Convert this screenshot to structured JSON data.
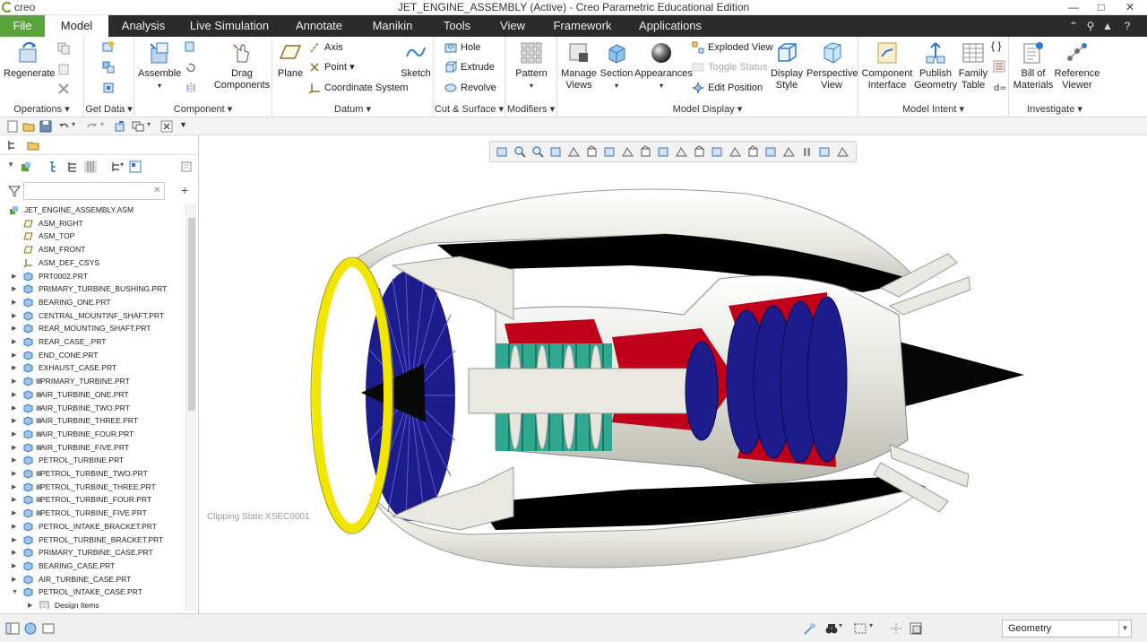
{
  "app": {
    "logo_text": "creo",
    "title": "JET_ENGINE_ASSEMBLY (Active) - Creo Parametric Educational Edition"
  },
  "tabs": [
    "File",
    "Model",
    "Analysis",
    "Live Simulation",
    "Annotate",
    "Manikin",
    "Tools",
    "View",
    "Framework",
    "Applications"
  ],
  "ribbon": {
    "operations": {
      "label": "Operations",
      "regenerate": "Regenerate"
    },
    "get_data": {
      "label": "Get Data"
    },
    "component": {
      "label": "Component",
      "assemble": "Assemble",
      "drag": "Drag\nComponents"
    },
    "datum": {
      "label": "Datum",
      "plane": "Plane",
      "axis": "Axis",
      "point": "Point",
      "csys": "Coordinate System",
      "sketch": "Sketch"
    },
    "cut_surface": {
      "label": "Cut & Surface",
      "hole": "Hole",
      "extrude": "Extrude",
      "revolve": "Revolve"
    },
    "modifiers": {
      "label": "Modifiers",
      "pattern": "Pattern"
    },
    "model_display": {
      "label": "Model Display",
      "manage_views": "Manage\nViews",
      "section": "Section",
      "appearances": "Appearances",
      "exploded_view": "Exploded View",
      "toggle_status": "Toggle Status",
      "edit_position": "Edit Position",
      "display_style": "Display\nStyle",
      "perspective_view": "Perspective\nView"
    },
    "model_intent": {
      "label": "Model Intent",
      "component_interface": "Component\nInterface",
      "publish_geometry": "Publish\nGeometry",
      "family_table": "Family\nTable"
    },
    "investigate": {
      "label": "Investigate",
      "bom": "Bill of\nMaterials",
      "reference_viewer": "Reference\nViewer"
    }
  },
  "tree": {
    "search_value": "",
    "root": "JET_ENGINE_ASSEMBLY.ASM",
    "items": [
      {
        "label": "ASM_RIGHT",
        "kind": "datum",
        "exp": false
      },
      {
        "label": "ASM_TOP",
        "kind": "datum",
        "exp": false
      },
      {
        "label": "ASM_FRONT",
        "kind": "datum",
        "exp": false
      },
      {
        "label": "ASM_DEF_CSYS",
        "kind": "csys",
        "exp": false
      },
      {
        "label": "PRT0002.PRT",
        "kind": "part",
        "exp": true
      },
      {
        "label": "PRIMARY_TURBINE_BUSHING.PRT",
        "kind": "part",
        "exp": true
      },
      {
        "label": "BEARING_ONE.PRT",
        "kind": "part",
        "exp": true
      },
      {
        "label": "CENTRAL_MOUNTINF_SHAFT.PRT",
        "kind": "part",
        "exp": true
      },
      {
        "label": "REAR_MOUNTING_SHAFT.PRT",
        "kind": "part",
        "exp": true
      },
      {
        "label": "REAR_CASE_.PRT",
        "kind": "part",
        "exp": true
      },
      {
        "label": "END_CONE.PRT",
        "kind": "part",
        "exp": true
      },
      {
        "label": "EXHAUST_CASE.PRT",
        "kind": "part",
        "exp": true
      },
      {
        "label": "PRIMARY_TURBINE.PRT",
        "kind": "part-ref",
        "exp": true
      },
      {
        "label": "AIR_TURBINE_ONE.PRT",
        "kind": "part-ref",
        "exp": true
      },
      {
        "label": "AIR_TURBINE_TWO.PRT",
        "kind": "part-ref",
        "exp": true
      },
      {
        "label": "AIR_TURBINE_THREE.PRT",
        "kind": "part-ref",
        "exp": true
      },
      {
        "label": "AIR_TURBINE_FOUR.PRT",
        "kind": "part-ref",
        "exp": true
      },
      {
        "label": "AIR_TURBINE_FIVE.PRT",
        "kind": "part-ref",
        "exp": true
      },
      {
        "label": "PETROL_TURBINE.PRT",
        "kind": "part",
        "exp": true
      },
      {
        "label": "PETROL_TURBINE_TWO.PRT",
        "kind": "part-ref",
        "exp": true
      },
      {
        "label": "PETROL_TURBINE_THREE.PRT",
        "kind": "part-ref",
        "exp": true
      },
      {
        "label": "PETROL_TURBINE_FOUR.PRT",
        "kind": "part-ref",
        "exp": true
      },
      {
        "label": "PETROL_TURBINE_FIVE.PRT",
        "kind": "part-ref",
        "exp": true
      },
      {
        "label": "PETROL_INTAKE_BRACKET.PRT",
        "kind": "part",
        "exp": true
      },
      {
        "label": "PETROL_TURBINE_BRACKET.PRT",
        "kind": "part",
        "exp": true
      },
      {
        "label": "PRIMARY_TURBINE_CASE.PRT",
        "kind": "part",
        "exp": true
      },
      {
        "label": "BEARING_CASE.PRT",
        "kind": "part",
        "exp": true
      },
      {
        "label": "AIR_TURBINE_CASE.PRT",
        "kind": "part",
        "exp": true
      },
      {
        "label": "PETROL_INTAKE_CASE.PRT",
        "kind": "part",
        "exp": "open"
      },
      {
        "label": "Design Items",
        "kind": "design",
        "exp": true
      }
    ]
  },
  "viewport": {
    "clip_state": "Clipping State:XSEC0001"
  },
  "status": {
    "filter_value": "Geometry"
  },
  "colors": {
    "file_tab": "#5aa33a",
    "tab_bar": "#2b2b2b",
    "ring": "#f2e600",
    "fan": "#1c1c8c",
    "compressor": "#2fa88f",
    "combustor": "#c0001a",
    "nacelle": "#efefe9"
  }
}
